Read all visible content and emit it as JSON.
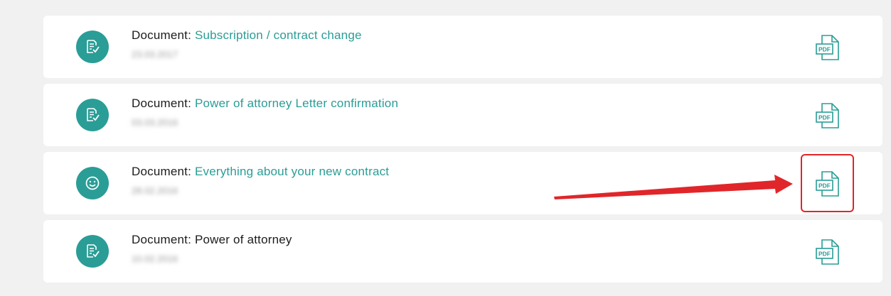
{
  "documents": [
    {
      "prefix": "Document:",
      "name": "Subscription / contract change",
      "linked": true,
      "date": "23.03.2017",
      "icon": "document-check-icon",
      "pdf_label": "PDF"
    },
    {
      "prefix": "Document:",
      "name": "Power of attorney Letter confirmation",
      "linked": true,
      "date": "03.03.2016",
      "icon": "document-check-icon",
      "pdf_label": "PDF"
    },
    {
      "prefix": "Document:",
      "name": "Everything about your new contract",
      "linked": true,
      "date": "28.02.2016",
      "icon": "smiley-icon",
      "pdf_label": "PDF"
    },
    {
      "prefix": "Document:",
      "name": "Power of attorney",
      "linked": false,
      "date": "10.02.2016",
      "icon": "document-check-icon",
      "pdf_label": "PDF"
    }
  ],
  "colors": {
    "accent": "#2a9d96",
    "text": "#1c1c1c",
    "background": "#f1f1f1",
    "card": "#ffffff",
    "annotation": "#e0262a"
  }
}
